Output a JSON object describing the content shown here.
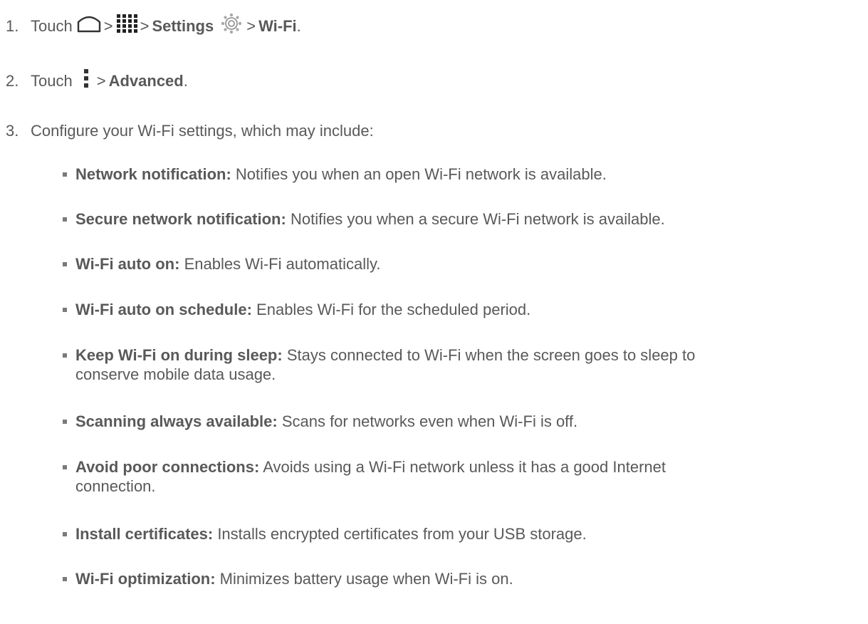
{
  "steps": [
    {
      "number": "1.",
      "prefix": "Touch",
      "gt": ">",
      "settings_label": "Settings",
      "wifi_label": "Wi-Fi",
      "period": ".",
      "icons": [
        "home-icon",
        "apps-grid-icon",
        "settings-gear-icon"
      ]
    },
    {
      "number": "2.",
      "prefix": "Touch",
      "gt": ">",
      "advanced_label": "Advanced",
      "period": ".",
      "icons": [
        "menu-dots-icon"
      ]
    },
    {
      "number": "3.",
      "text": "Configure your Wi-Fi settings, which may include:"
    }
  ],
  "options": [
    {
      "title": "Network notification:",
      "desc": "Notifies you when an open Wi-Fi network is available."
    },
    {
      "title": "Secure network notification:",
      "desc": "Notifies you when a secure Wi-Fi network is available."
    },
    {
      "title": "Wi-Fi auto on:",
      "desc": "Enables Wi-Fi automatically."
    },
    {
      "title": "Wi-Fi auto on schedule:",
      "desc": "Enables Wi-Fi for the scheduled period."
    },
    {
      "title": "Keep Wi-Fi on during sleep:",
      "desc": "Stays connected to Wi-Fi when the screen goes to sleep to conserve mobile data usage."
    },
    {
      "title": "Scanning always available:",
      "desc": "Scans for networks even when Wi-Fi is off."
    },
    {
      "title": "Avoid poor connections:",
      "desc": "Avoids using a Wi-Fi network unless it has a good Internet connection."
    },
    {
      "title": "Install certificates:",
      "desc": "Installs encrypted certificates from your USB storage."
    },
    {
      "title": "Wi-Fi optimization:",
      "desc": "Minimizes battery usage when Wi-Fi is on."
    }
  ],
  "colors": {
    "text": "#595959",
    "bullet": "#7a7a7a",
    "background": "#ffffff"
  }
}
